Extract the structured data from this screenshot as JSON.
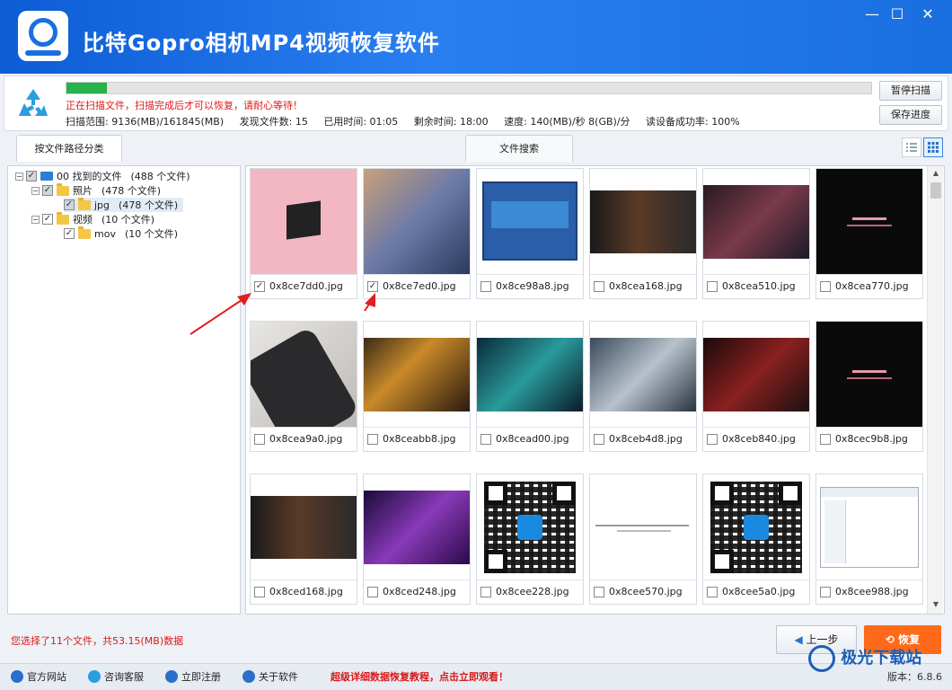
{
  "window": {
    "title": "比特Gopro相机MP4视频恢复软件",
    "controls": [
      "—",
      "☐",
      "✕"
    ]
  },
  "scan": {
    "progress_fraction": 0.05,
    "message": "正在扫描文件，扫描完成后才可以恢复，请耐心等待！",
    "stats": [
      "扫描范围: 9136(MB)/161845(MB)",
      "发现文件数: 15",
      "已用时间: 01:05",
      "剩余时间: 18:00",
      "速度: 140(MB)/秒 8(GB)/分",
      "读设备成功率: 100%"
    ],
    "pause_label": "暂停扫描",
    "save_label": "保存进度"
  },
  "tabs": {
    "by_path": "按文件路径分类",
    "search": "文件搜索"
  },
  "tree": {
    "root_label": "00 找到的文件",
    "root_count": "(488 个文件)",
    "photos_label": "照片",
    "photos_count": "(478 个文件)",
    "jpg_label": "jpg",
    "jpg_count": "(478 个文件)",
    "videos_label": "视频",
    "videos_count": "(10 个文件)",
    "mov_label": "mov",
    "mov_count": "(10 个文件)"
  },
  "files": [
    {
      "name": "0x8ce7dd0.jpg",
      "checked": true,
      "thumb": "pink-album"
    },
    {
      "name": "0x8ce7ed0.jpg",
      "checked": true,
      "thumb": "anime-girl"
    },
    {
      "name": "0x8ce98a8.jpg",
      "checked": false,
      "thumb": "software-window"
    },
    {
      "name": "0x8cea168.jpg",
      "checked": false,
      "thumb": "portrait"
    },
    {
      "name": "0x8cea510.jpg",
      "checked": false,
      "thumb": "dark-art"
    },
    {
      "name": "0x8cea770.jpg",
      "checked": false,
      "thumb": "blackpink"
    },
    {
      "name": "0x8cea9a0.jpg",
      "checked": false,
      "thumb": "phone"
    },
    {
      "name": "0x8ceabb8.jpg",
      "checked": false,
      "thumb": "warrior"
    },
    {
      "name": "0x8cead00.jpg",
      "checked": false,
      "thumb": "teal-art"
    },
    {
      "name": "0x8ceb4d8.jpg",
      "checked": false,
      "thumb": "grey-art"
    },
    {
      "name": "0x8ceb840.jpg",
      "checked": false,
      "thumb": "red-art"
    },
    {
      "name": "0x8cec9b8.jpg",
      "checked": false,
      "thumb": "blackpink"
    },
    {
      "name": "0x8ced168.jpg",
      "checked": false,
      "thumb": "portrait"
    },
    {
      "name": "0x8ced248.jpg",
      "checked": false,
      "thumb": "purple-art"
    },
    {
      "name": "0x8cee228.jpg",
      "checked": false,
      "thumb": "qr"
    },
    {
      "name": "0x8cee570.jpg",
      "checked": false,
      "thumb": "document"
    },
    {
      "name": "0x8cee5a0.jpg",
      "checked": false,
      "thumb": "qr"
    },
    {
      "name": "0x8cee988.jpg",
      "checked": false,
      "thumb": "screenshot"
    }
  ],
  "bottom": {
    "selection_info": "您选择了11个文件，共53.15(MB)数据",
    "prev_label": "上一步",
    "recover_label": "恢复"
  },
  "footer": {
    "links": [
      "官方网站",
      "咨询客服",
      "立即注册",
      "关于软件"
    ],
    "promo": "超级详细数据恢复教程，点击立即观看！",
    "version": "版本：6.8.6"
  },
  "watermark": "极光下载站",
  "colors": {
    "titlebar": "#1a6fe0",
    "progress": "#27b24a",
    "alert": "#e01818",
    "recover": "#ff6a1a"
  }
}
